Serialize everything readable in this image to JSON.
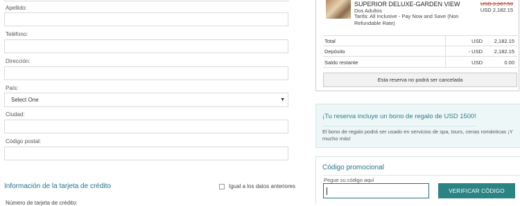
{
  "form": {
    "apellido_label": "Apellido:",
    "telefono_label": "Teléfono:",
    "direccion_label": "Dirección:",
    "pais_label": "País:",
    "pais_selected": "Select One",
    "ciudad_label": "Ciudad:",
    "postal_label": "Código postal:",
    "card_section_title": "Información de la tarjeta de crédito",
    "copy_checkbox_label": "Igual a los datos anteriores",
    "card_number_label": "Número de tarjeta de crédito:"
  },
  "summary": {
    "room_name": "SUPERIOR DELUXE-GARDEN VIEW",
    "guests": "Dos Adultos",
    "rate": "Tarifa: All Inclusive - Pay Now and Save (Non Refundable Rate)",
    "old_price": "USD 3,967.50",
    "new_price": "USD 2,182.15",
    "rows": [
      {
        "label": "Total",
        "currency": "USD",
        "amount": "2,182.15"
      },
      {
        "label": "Depósito",
        "currency": "- USD",
        "amount": "2,182.15"
      },
      {
        "label": "Saldo restante",
        "currency": "USD",
        "amount": "0.00"
      }
    ],
    "cancel_note": "Esta reserva no podrá ser cancelada"
  },
  "gift": {
    "title": "¡Tu reserva incluye un bono de regalo de USD 1500!",
    "text": "El bono de regalo podrá ser usado en servicios de spa, tours, cenas románticas ¡Y mucho más!"
  },
  "promo": {
    "title": "Código promocional",
    "hint": "Pegue su código aquí",
    "input_value": "",
    "button_label": "VERIFICAR CÓDIGO"
  },
  "icons": {
    "select_caret": "caret-down-icon",
    "checkbox": "checkbox-icon"
  },
  "colors": {
    "accent": "#1f6f8b",
    "button": "#2b8484",
    "strike_price": "#c0392b",
    "gift_bg": "#eef7f7"
  }
}
